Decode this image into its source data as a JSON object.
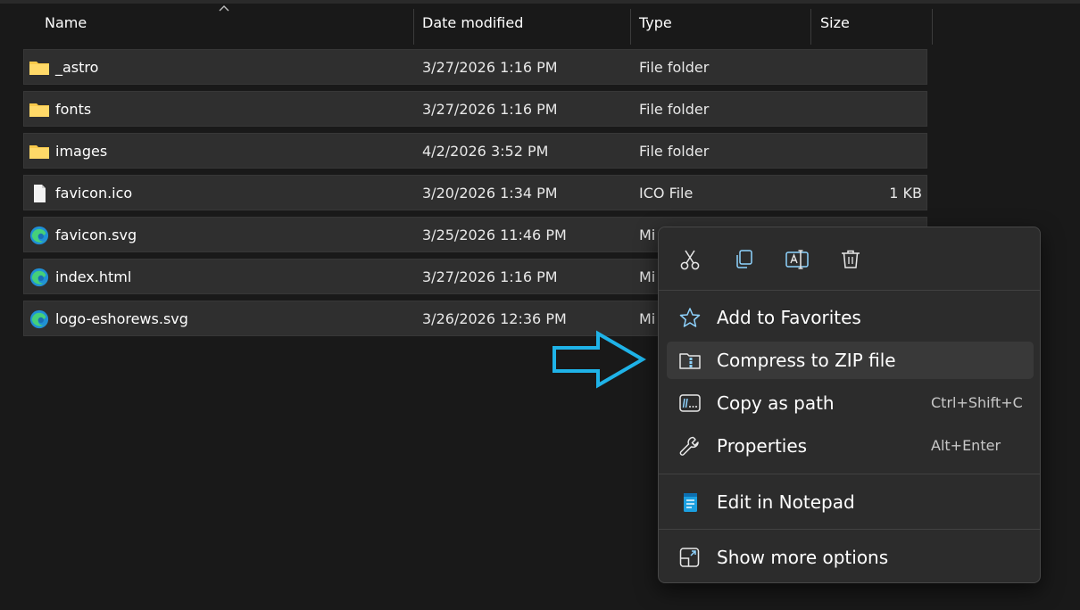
{
  "columns": {
    "name": "Name",
    "date_modified": "Date modified",
    "type": "Type",
    "size": "Size"
  },
  "sort": {
    "column": "Name",
    "direction": "ascending"
  },
  "files": [
    {
      "name": "_astro",
      "date": "3/27/2026 1:16 PM",
      "type": "File folder",
      "size": "",
      "icon": "folder-icon"
    },
    {
      "name": "fonts",
      "date": "3/27/2026 1:16 PM",
      "type": "File folder",
      "size": "",
      "icon": "folder-icon"
    },
    {
      "name": "images",
      "date": "4/2/2026 3:52 PM",
      "type": "File folder",
      "size": "",
      "icon": "folder-icon"
    },
    {
      "name": "favicon.ico",
      "date": "3/20/2026 1:34 PM",
      "type": "ICO File",
      "size": "1 KB",
      "icon": "file-icon"
    },
    {
      "name": "favicon.svg",
      "date": "3/25/2026 11:46 PM",
      "type": "Mi",
      "size": "",
      "icon": "edge-icon"
    },
    {
      "name": "index.html",
      "date": "3/27/2026 1:16 PM",
      "type": "Mi",
      "size": "",
      "icon": "edge-icon"
    },
    {
      "name": "logo-eshorews.svg",
      "date": "3/26/2026 12:36 PM",
      "type": "Mi",
      "size": "",
      "icon": "edge-icon"
    }
  ],
  "context_menu": {
    "quick_actions": [
      "cut-icon",
      "copy-icon",
      "rename-icon",
      "delete-icon"
    ],
    "items": [
      {
        "label": "Add to Favorites",
        "shortcut": "",
        "icon": "star-icon"
      },
      {
        "label": "Compress to ZIP file",
        "shortcut": "",
        "icon": "zip-folder-icon",
        "highlighted": true
      },
      {
        "label": "Copy as path",
        "shortcut": "Ctrl+Shift+C",
        "icon": "copy-path-icon"
      },
      {
        "label": "Properties",
        "shortcut": "Alt+Enter",
        "icon": "wrench-icon"
      },
      {
        "label": "Edit in Notepad",
        "shortcut": "",
        "icon": "notepad-icon"
      },
      {
        "label": "Show more options",
        "shortcut": "",
        "icon": "more-options-icon"
      }
    ]
  },
  "colors": {
    "background": "#191919",
    "row": "#2f2f2f",
    "menu": "#2c2c2c",
    "accent": "#60cdff",
    "folder": "#f8c94a",
    "arrow": "#1fb3e8"
  }
}
